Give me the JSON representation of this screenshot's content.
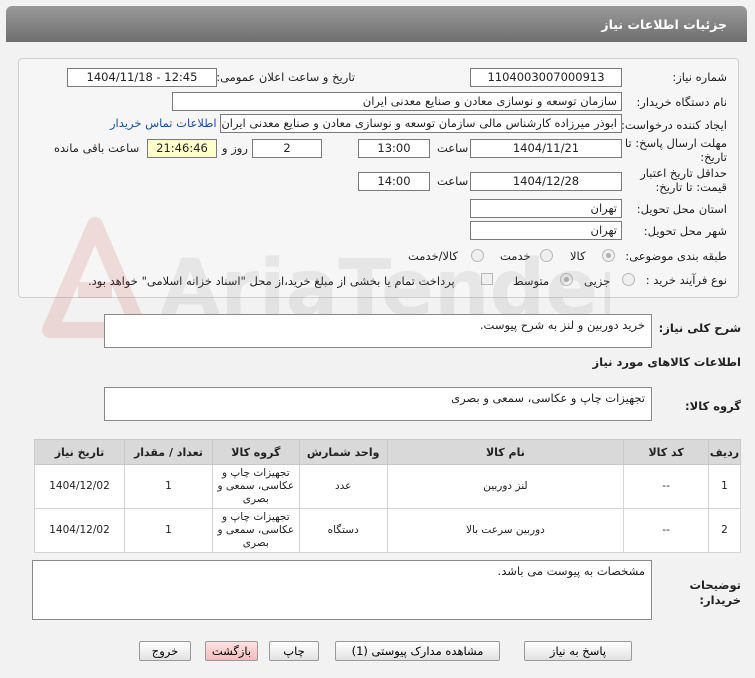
{
  "header": {
    "title": "جزئیات اطلاعات نیاز"
  },
  "fields": {
    "need_number_label": "شماره نیاز:",
    "need_number": "1104003007000913",
    "announce_label": "تاریخ و ساعت اعلان عمومی:",
    "announce_value": "1404/11/18 - 12:45",
    "buyer_org_label": "نام دستگاه خریدار:",
    "buyer_org": "سازمان توسعه و نوسازی معادن و صنایع معدنی ایران",
    "creator_label": "ایجاد کننده درخواست:",
    "creator": "ابوذر میرزاده  کارشناس مالی  سازمان توسعه و نوسازی معادن و صنایع معدنی ایران",
    "contact_link": "اطلاعات تماس خریدار",
    "reply_deadline_label": "مهلت ارسال پاسخ: تا تاریخ:",
    "reply_date": "1404/11/21",
    "time_label": "ساعت",
    "reply_time": "13:00",
    "days": "2",
    "days_label": "روز و",
    "remaining_time": "21:46:46",
    "remaining_label": "ساعت باقی مانده",
    "validity_label": "حداقل تاریخ اعتبار قیمت: تا تاریخ:",
    "validity_date": "1404/12/28",
    "validity_time": "14:00",
    "province_label": "استان محل تحویل:",
    "province": "تهران",
    "city_label": "شهر محل تحویل:",
    "city": "تهران",
    "category_label": "طبقه بندی موضوعی:",
    "category_options": [
      "کالا",
      "خدمت",
      "کالا/خدمت"
    ],
    "process_label": "نوع فرآیند خرید :",
    "process_options": [
      "جزیی",
      "متوسط"
    ],
    "payment_note": "پرداخت تمام یا بخشی از مبلغ خرید،از محل \"اسناد خزانه اسلامی\" خواهد بود."
  },
  "description": {
    "label": "شرح کلی نیاز:",
    "value": "خرید دوربین و لنز به شرح پیوست."
  },
  "goods_info_title": "اطلاعات کالاهای مورد نیاز",
  "goods_group": {
    "label": "گروه کالا:",
    "value": "تجهیزات چاپ و عکاسی، سمعی و بصری"
  },
  "table": {
    "headers": [
      "ردیف",
      "کد کالا",
      "نام کالا",
      "واحد شمارش",
      "گروه کالا",
      "تعداد / مقدار",
      "تاریخ نیاز"
    ],
    "rows": [
      [
        "1",
        "--",
        "لنز دوربین",
        "عدد",
        "تجهیزات چاپ و عکاسی، سمعی و بصری",
        "1",
        "1404/12/02"
      ],
      [
        "2",
        "--",
        "دوربین سرعت بالا",
        "دستگاه",
        "تجهیزات چاپ و عکاسی، سمعی و بصری",
        "1",
        "1404/12/02"
      ]
    ]
  },
  "buyer_notes": {
    "label": "توضیحات خریدار:",
    "value": "مشخصات به پیوست می باشد."
  },
  "buttons": {
    "reply": "پاسخ به نیاز",
    "attachments": "مشاهده مدارک پیوستی (1)",
    "print": "چاپ",
    "back": "بازگشت",
    "exit": "خروج"
  },
  "watermark_text": "AriaTender.net",
  "colors": {
    "header": "#7f7f7f",
    "link": "#1a4fa0",
    "highlight": "#ffffcc",
    "pink_button": "#f3bcbc"
  }
}
